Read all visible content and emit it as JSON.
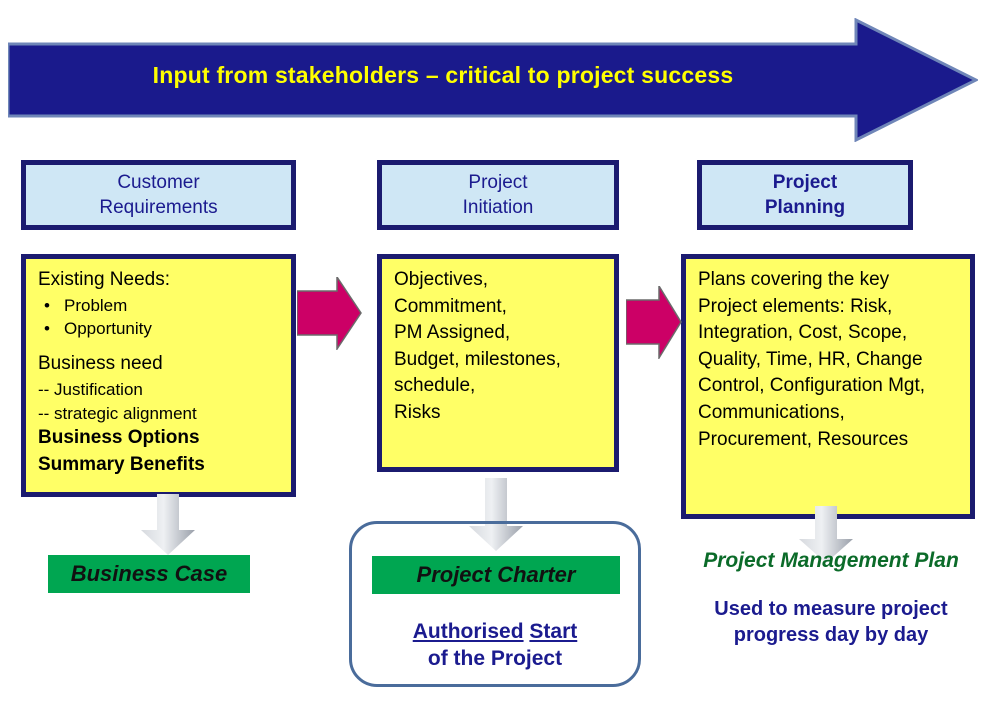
{
  "banner": {
    "title": "Input from stakeholders – critical to project success",
    "fill_color": "#1a1a8c",
    "text_color": "#ffff00",
    "icon": "right-block-arrow"
  },
  "colors": {
    "header_box_fill": "#cfe7f5",
    "box_border": "#1b1b6f",
    "content_box_fill": "#ffff66",
    "connector_arrow": "#cc0066",
    "flow_arrow": "#b8bcc4",
    "result_box_fill": "#00a651",
    "navy_text": "#1b1b8f",
    "green_text": "#0b6b29"
  },
  "stages": [
    {
      "header": "Customer\nRequirements",
      "header_line_1": "Customer",
      "header_line_2": "Requirements",
      "header_bold": false,
      "lines": [
        {
          "text": "Existing Needs:",
          "style": "normal"
        },
        {
          "text": "Problem",
          "style": "bullet"
        },
        {
          "text": "Opportunity",
          "style": "bullet"
        },
        {
          "text": "",
          "style": "gap"
        },
        {
          "text": "Business need",
          "style": "normal"
        },
        {
          "text": "-- Justification",
          "style": "small"
        },
        {
          "text": "-- strategic alignment",
          "style": "small"
        },
        {
          "text": "Business Options",
          "style": "bold"
        },
        {
          "text": "Summary Benefits",
          "style": "bold"
        }
      ],
      "result": "Business Case"
    },
    {
      "header": "Project\nInitiation",
      "header_line_1": "Project",
      "header_line_2": "Initiation",
      "header_bold": false,
      "lines": [
        {
          "text": "Objectives,",
          "style": "normal"
        },
        {
          "text": "Commitment,",
          "style": "normal"
        },
        {
          "text": "PM Assigned,",
          "style": "normal"
        },
        {
          "text": "Budget, milestones,",
          "style": "normal"
        },
        {
          "text": "schedule,",
          "style": "normal"
        },
        {
          "text": "Risks",
          "style": "normal"
        }
      ],
      "result": "Project Charter",
      "caption_line_1_part_1": "Authorised",
      "caption_line_1_part_2": "Start",
      "caption_line_2": "of the Project"
    },
    {
      "header": "Project\nPlanning",
      "header_line_1": "Project",
      "header_line_2": "Planning",
      "header_bold": true,
      "lines": [
        {
          "text": "Plans covering the key",
          "style": "normal"
        },
        {
          "text": "Project elements: Risk,",
          "style": "normal"
        },
        {
          "text": "Integration, Cost, Scope,",
          "style": "normal"
        },
        {
          "text": "Quality, Time, HR, Change",
          "style": "normal"
        },
        {
          "text": "Control, Configuration Mgt,",
          "style": "normal"
        },
        {
          "text": "Communications,",
          "style": "normal"
        },
        {
          "text": "Procurement, Resources",
          "style": "normal"
        }
      ],
      "result": "Project Management Plan",
      "caption_line_1": "Used to measure project",
      "caption_line_2": "progress day by day"
    }
  ]
}
